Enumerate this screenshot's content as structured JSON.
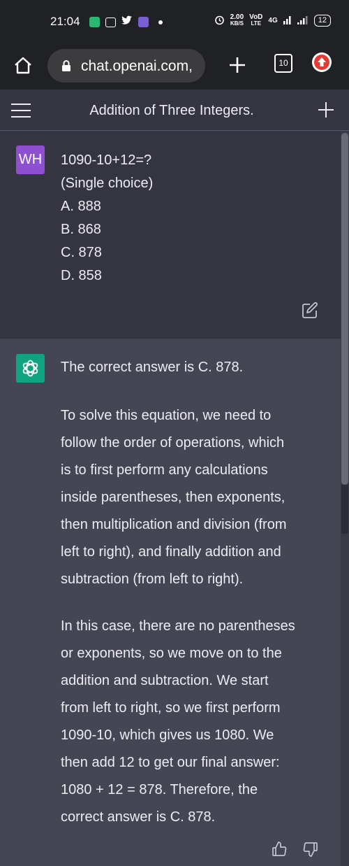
{
  "status_bar": {
    "time": "21:04",
    "speed_value": "2.00",
    "speed_unit": "KB/S",
    "volte_top": "VoD",
    "volte_bottom": "LTE",
    "network": "4G",
    "battery": "12",
    "icons": [
      "app-icon",
      "app-icon",
      "twitter-icon",
      "app-icon",
      "alarm-icon",
      "signal-icon",
      "signal-icon"
    ]
  },
  "browser": {
    "url": "chat.openai.com,",
    "tab_count": "10",
    "icons": [
      "home-icon",
      "lock-icon",
      "plus-icon",
      "upload-arrow-icon"
    ]
  },
  "header": {
    "title": "Addition of Three Integers.",
    "icons": [
      "hamburger-menu-icon",
      "plus-icon"
    ]
  },
  "user_message": {
    "avatar": "WH",
    "lines": [
      "1090-10+12=?",
      "(Single choice)",
      "A. 888",
      "B. 868",
      "C. 878",
      "D. 858"
    ]
  },
  "assistant_message": {
    "paragraph_1": "The correct answer is C. 878.",
    "paragraph_2": [
      "To solve this equation, we need to",
      "follow the order of operations, which",
      "is to first perform any calculations",
      "inside parentheses, then exponents,",
      "then multiplication and division (from",
      "left to right), and finally addition and",
      "subtraction (from left to right)."
    ],
    "paragraph_3": [
      "In this case, there are no parentheses",
      "or exponents, so we move on to the",
      "addition and subtraction. We start",
      "from left to right, so we first perform",
      "1090-10, which gives us 1080. We",
      "then add 12 to get our final answer:",
      "1080 + 12 = 878. Therefore, the",
      "correct answer is C. 878."
    ]
  },
  "colors": {
    "accent_user": "#8e4fd0",
    "accent_gpt": "#10a37f",
    "bg_dark": "#343541",
    "bg_assistant": "#444654"
  }
}
